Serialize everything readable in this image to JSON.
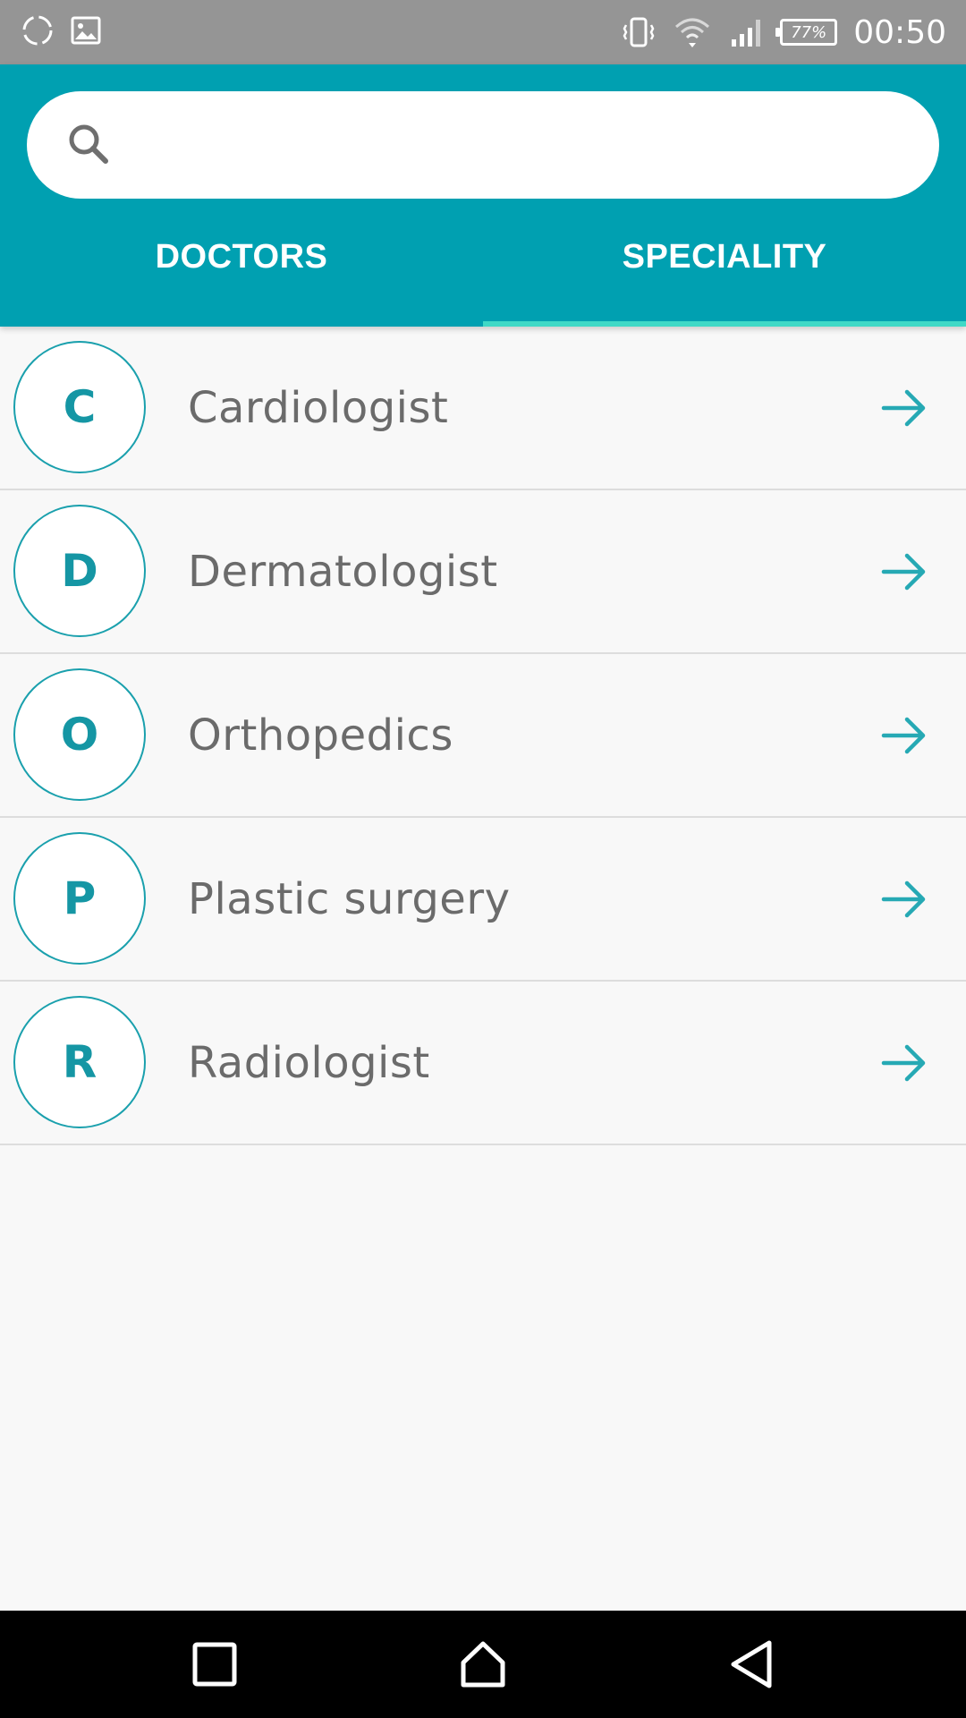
{
  "status_bar": {
    "time": "00:50",
    "battery": "77%",
    "icons": [
      "sync-icon",
      "image-icon",
      "vibrate-icon",
      "wifi-icon",
      "signal-icon",
      "battery-icon"
    ]
  },
  "search": {
    "placeholder": "",
    "value": ""
  },
  "tabs": [
    {
      "label": "DOCTORS",
      "selected": false
    },
    {
      "label": "SPECIALITY",
      "selected": true
    }
  ],
  "specialities": [
    {
      "initial": "C",
      "name": "Cardiologist"
    },
    {
      "initial": "D",
      "name": "Dermatologist"
    },
    {
      "initial": "O",
      "name": "Orthopedics"
    },
    {
      "initial": "P",
      "name": "Plastic surgery"
    },
    {
      "initial": "R",
      "name": "Radiologist"
    }
  ],
  "colors": {
    "primary": "#00a0b1",
    "tab_indicator": "#3fd9c6",
    "accent_text": "#1596a4",
    "status_bar": "#959595",
    "nav_bar": "#000000"
  },
  "nav_bar": [
    "recents-icon",
    "home-icon",
    "back-icon"
  ]
}
